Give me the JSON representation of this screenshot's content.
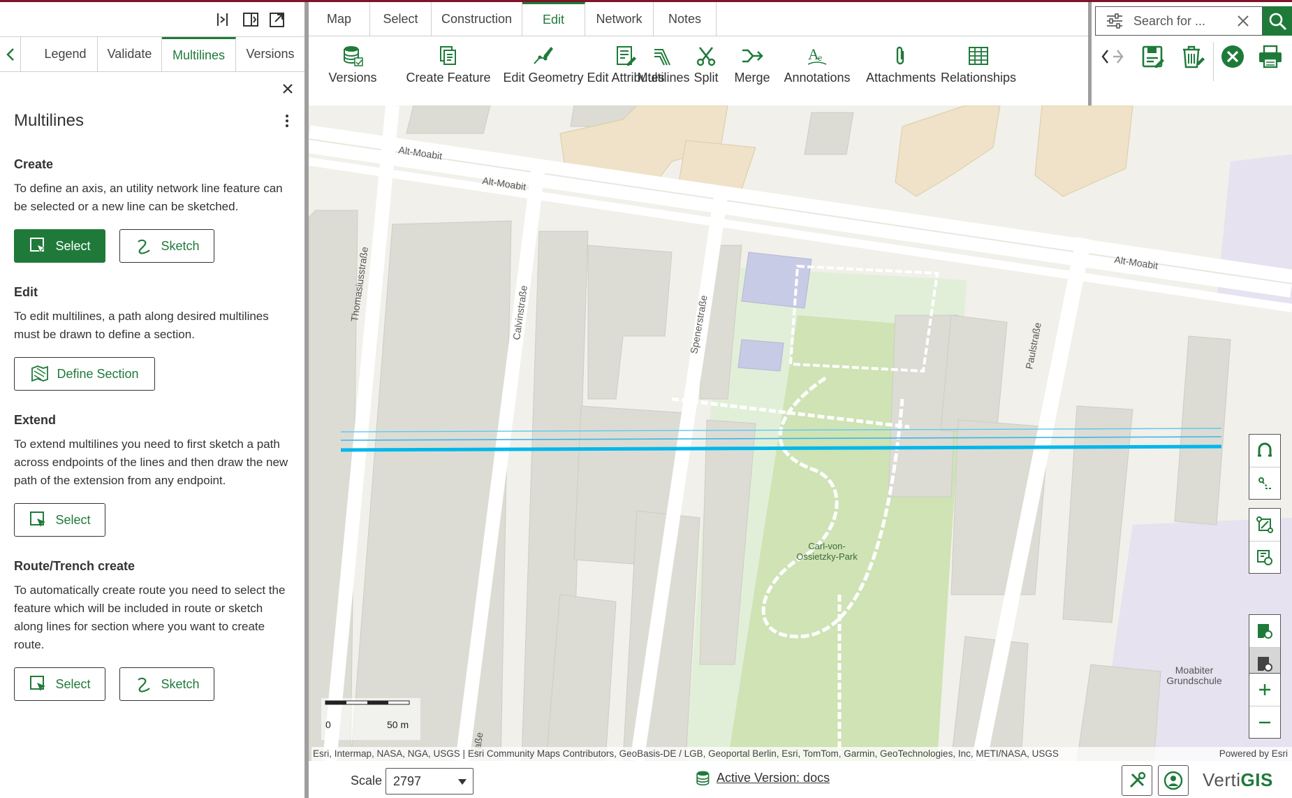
{
  "panel": {
    "tabs": [
      {
        "label": "Legend"
      },
      {
        "label": "Validate"
      },
      {
        "label": "Multilines",
        "active": true
      },
      {
        "label": "Versions"
      }
    ],
    "title": "Multilines",
    "sections": {
      "create": {
        "title": "Create",
        "text": "To define an axis, an utility network line feature can be selected or a new line can be sketched.",
        "select_label": "Select",
        "sketch_label": "Sketch"
      },
      "edit": {
        "title": "Edit",
        "text": "To edit multilines, a path along desired multilines must be drawn to define a section.",
        "define_label": "Define Section"
      },
      "extend": {
        "title": "Extend",
        "text": "To extend multilines you need to first sketch a path across endpoints of the lines and then draw the new path of the extension from any endpoint.",
        "select_label": "Select"
      },
      "route": {
        "title": "Route/Trench create",
        "text": "To automatically create route you need to select the feature which will be included in route or sketch along lines for section where you want to create route.",
        "select_label": "Select",
        "sketch_label": "Sketch"
      }
    }
  },
  "main_tabs": [
    {
      "label": "Map"
    },
    {
      "label": "Select"
    },
    {
      "label": "Construction"
    },
    {
      "label": "Edit",
      "active": true
    },
    {
      "label": "Network"
    },
    {
      "label": "Notes"
    }
  ],
  "tools": [
    {
      "label": "Versions",
      "icon": "versions-icon"
    },
    {
      "label": "Create Feature",
      "icon": "create-feature-icon"
    },
    {
      "label": "Edit Geometry",
      "icon": "edit-geometry-icon"
    },
    {
      "label": "Edit Attributes",
      "icon": "edit-attributes-icon"
    },
    {
      "label": "Multilines",
      "icon": "multilines-icon"
    },
    {
      "label": "Split",
      "icon": "scissors-icon"
    },
    {
      "label": "Merge",
      "icon": "merge-icon"
    },
    {
      "label": "Annotations",
      "icon": "annotations-icon"
    },
    {
      "label": "Attachments",
      "icon": "paperclip-icon"
    },
    {
      "label": "Relationships",
      "icon": "table-icon"
    }
  ],
  "search": {
    "placeholder": "Search for ..."
  },
  "map": {
    "streets": {
      "alt_moabit_1": "Alt-Moabit",
      "alt_moabit_2": "Alt-Moabit",
      "alt_moabit_3": "Alt-Moabit",
      "thomasius": "Thomasiusstraße",
      "calvin": "Calvinstraße",
      "spener": "Spenerstraße",
      "paul": "Paulstraße",
      "strasse": "traße"
    },
    "park_label_1": "Carl-von-",
    "park_label_2": "Ossietzky-Park",
    "school_label_1": "Moabiter",
    "school_label_2": "Grundschule",
    "scale_zero": "0",
    "scale_end": "50 m",
    "attribution": "Esri, Intermap, NASA, NGA, USGS | Esri Community Maps Contributors, GeoBasis-DE / LGB, Geoportal Berlin, Esri, TomTom, Garmin, GeoTechnologies, Inc, METI/NASA, USGS",
    "powered_by": "Powered by Esri",
    "colors": {
      "park": "#cfe3b5",
      "building": "#dcdcd4",
      "multiline": "#00b7eb",
      "accent": "#1f7a3a"
    }
  },
  "bottom": {
    "scale_label": "Scale",
    "scale_value": "2797",
    "active_version": "Active Version: docs",
    "logo_a": "Verti",
    "logo_b": "GIS"
  }
}
